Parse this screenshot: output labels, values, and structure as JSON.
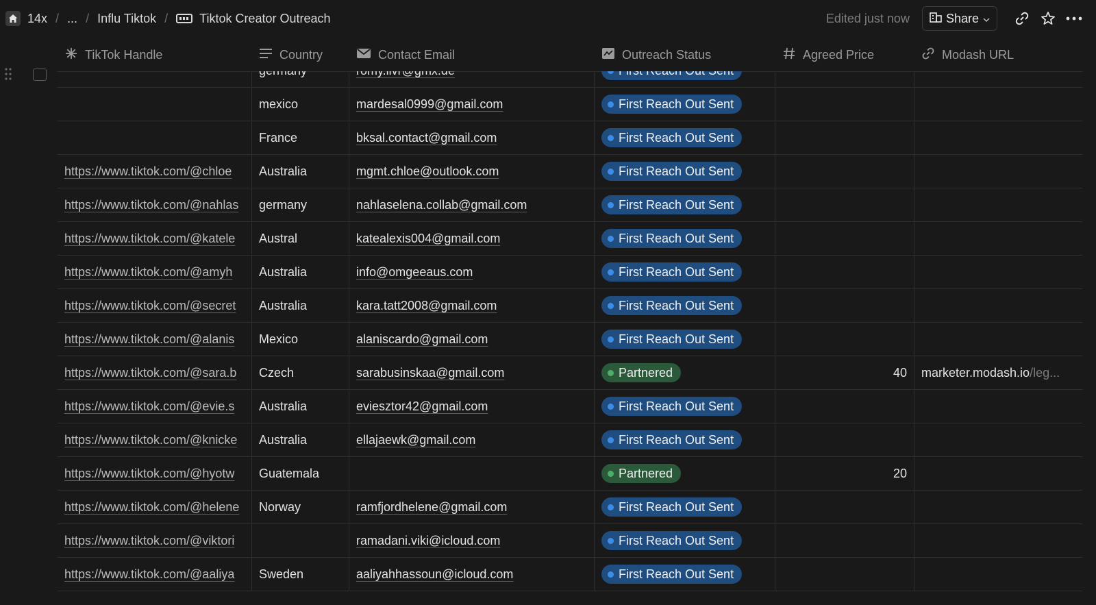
{
  "breadcrumb": {
    "workspace": "14x",
    "ellipsis": "...",
    "parent": "Influ Tiktok",
    "current": "Tiktok Creator Outreach"
  },
  "toolbar": {
    "edited": "Edited just now",
    "share_label": "Share"
  },
  "columns": {
    "handle": "TikTok Handle",
    "country": "Country",
    "email": "Contact Email",
    "status": "Outreach Status",
    "price": "Agreed Price",
    "url": "Modash URL"
  },
  "rows": [
    {
      "handle": "",
      "country": "germany",
      "email": "romy.livr@gmx.de",
      "status": "First Reach Out Sent",
      "price": "",
      "url_host": "",
      "url_tail": ""
    },
    {
      "handle": "",
      "country": "mexico",
      "email": "mardesal0999@gmail.com",
      "status": "First Reach Out Sent",
      "price": "",
      "url_host": "",
      "url_tail": ""
    },
    {
      "handle": "",
      "country": "France",
      "email": "bksal.contact@gmail.com",
      "status": "First Reach Out Sent",
      "price": "",
      "url_host": "",
      "url_tail": ""
    },
    {
      "handle": "https://www.tiktok.com/@chloe",
      "country": "Australia",
      "email": "mgmt.chloe@outlook.com",
      "status": "First Reach Out Sent",
      "price": "",
      "url_host": "",
      "url_tail": ""
    },
    {
      "handle": "https://www.tiktok.com/@nahlas",
      "country": "germany",
      "email": "nahlaselena.collab@gmail.com",
      "status": "First Reach Out Sent",
      "price": "",
      "url_host": "",
      "url_tail": ""
    },
    {
      "handle": "https://www.tiktok.com/@katele",
      "country": "Austral",
      "email": "katealexis004@gmail.com",
      "status": "First Reach Out Sent",
      "price": "",
      "url_host": "",
      "url_tail": ""
    },
    {
      "handle": "https://www.tiktok.com/@amyh",
      "country": "Australia",
      "email": "info@omgeeaus.com",
      "status": "First Reach Out Sent",
      "price": "",
      "url_host": "",
      "url_tail": ""
    },
    {
      "handle": "https://www.tiktok.com/@secret",
      "country": "Australia",
      "email": "kara.tatt2008@gmail.com",
      "status": "First Reach Out Sent",
      "price": "",
      "url_host": "",
      "url_tail": ""
    },
    {
      "handle": "https://www.tiktok.com/@alanis",
      "country": "Mexico",
      "email": "alaniscardo@gmail.com",
      "status": "First Reach Out Sent",
      "price": "",
      "url_host": "",
      "url_tail": ""
    },
    {
      "handle": "https://www.tiktok.com/@sara.b",
      "country": "Czech",
      "email": "sarabusinskaa@gmail.com",
      "status": "Partnered",
      "price": "40",
      "url_host": "marketer.modash.io",
      "url_tail": "/leg..."
    },
    {
      "handle": "https://www.tiktok.com/@evie.s",
      "country": "Australia",
      "email": "eviesztor42@gmail.com",
      "status": "First Reach Out Sent",
      "price": "",
      "url_host": "",
      "url_tail": ""
    },
    {
      "handle": "https://www.tiktok.com/@knicke",
      "country": "Australia",
      "email": "ellajaewk@gmail.com",
      "status": "First Reach Out Sent",
      "price": "",
      "url_host": "",
      "url_tail": ""
    },
    {
      "handle": "https://www.tiktok.com/@hyotw",
      "country": "Guatemala",
      "email": "",
      "status": "Partnered",
      "price": "20",
      "url_host": "",
      "url_tail": ""
    },
    {
      "handle": "https://www.tiktok.com/@helene",
      "country": "Norway",
      "email": "ramfjordhelene@gmail.com",
      "status": "First Reach Out Sent",
      "price": "",
      "url_host": "",
      "url_tail": ""
    },
    {
      "handle": "https://www.tiktok.com/@viktori",
      "country": "",
      "email": "ramadani.viki@icloud.com",
      "status": "First Reach Out Sent",
      "price": "",
      "url_host": "",
      "url_tail": ""
    },
    {
      "handle": "https://www.tiktok.com/@aaliya",
      "country": "Sweden",
      "email": "aaliyahhassoun@icloud.com",
      "status": "First Reach Out Sent",
      "price": "",
      "url_host": "",
      "url_tail": ""
    }
  ],
  "status_colors": {
    "First Reach Out Sent": "#1f4d80",
    "Partnered": "#2b5a3a"
  },
  "icons": {
    "home": "home-icon",
    "database": "database-icon",
    "share": "share-building-icon",
    "link": "link-icon",
    "star": "star-icon",
    "more": "more-icon",
    "handle": "asterisk-icon",
    "country": "text-lines-icon",
    "email": "mail-icon",
    "status": "status-icon",
    "price": "hash-icon",
    "url": "link-icon"
  }
}
